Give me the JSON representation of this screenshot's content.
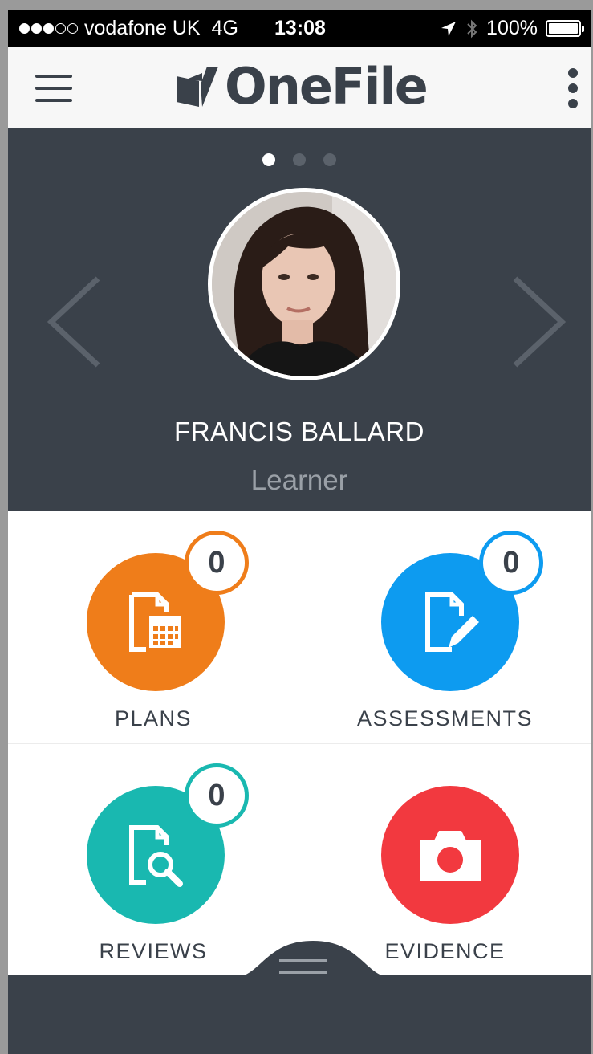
{
  "status_bar": {
    "carrier": "vodafone UK",
    "network": "4G",
    "time": "13:08",
    "battery": "100%",
    "signal_bars_filled": 3,
    "signal_bars_total": 5
  },
  "header": {
    "logo_text": "OneFile",
    "menu_icon": "hamburger-menu-icon",
    "more_icon": "more-vertical-icon"
  },
  "profile": {
    "carousel_pages": 3,
    "carousel_active_page": 1,
    "name": "FRANCIS BALLARD",
    "role": "Learner"
  },
  "tiles": [
    {
      "label": "PLANS",
      "count": "0",
      "color": "#ef7d1a",
      "icon": "plan-calendar-icon"
    },
    {
      "label": "ASSESSMENTS",
      "count": "0",
      "color": "#0d9bf0",
      "icon": "assessment-edit-icon"
    },
    {
      "label": "REVIEWS",
      "count": "0",
      "color": "#19b8b0",
      "icon": "review-search-icon"
    },
    {
      "label": "EVIDENCE",
      "count": null,
      "color": "#f2393f",
      "icon": "camera-icon"
    }
  ],
  "colors": {
    "dark": "#3a414a",
    "muted": "#9aa0a7"
  }
}
